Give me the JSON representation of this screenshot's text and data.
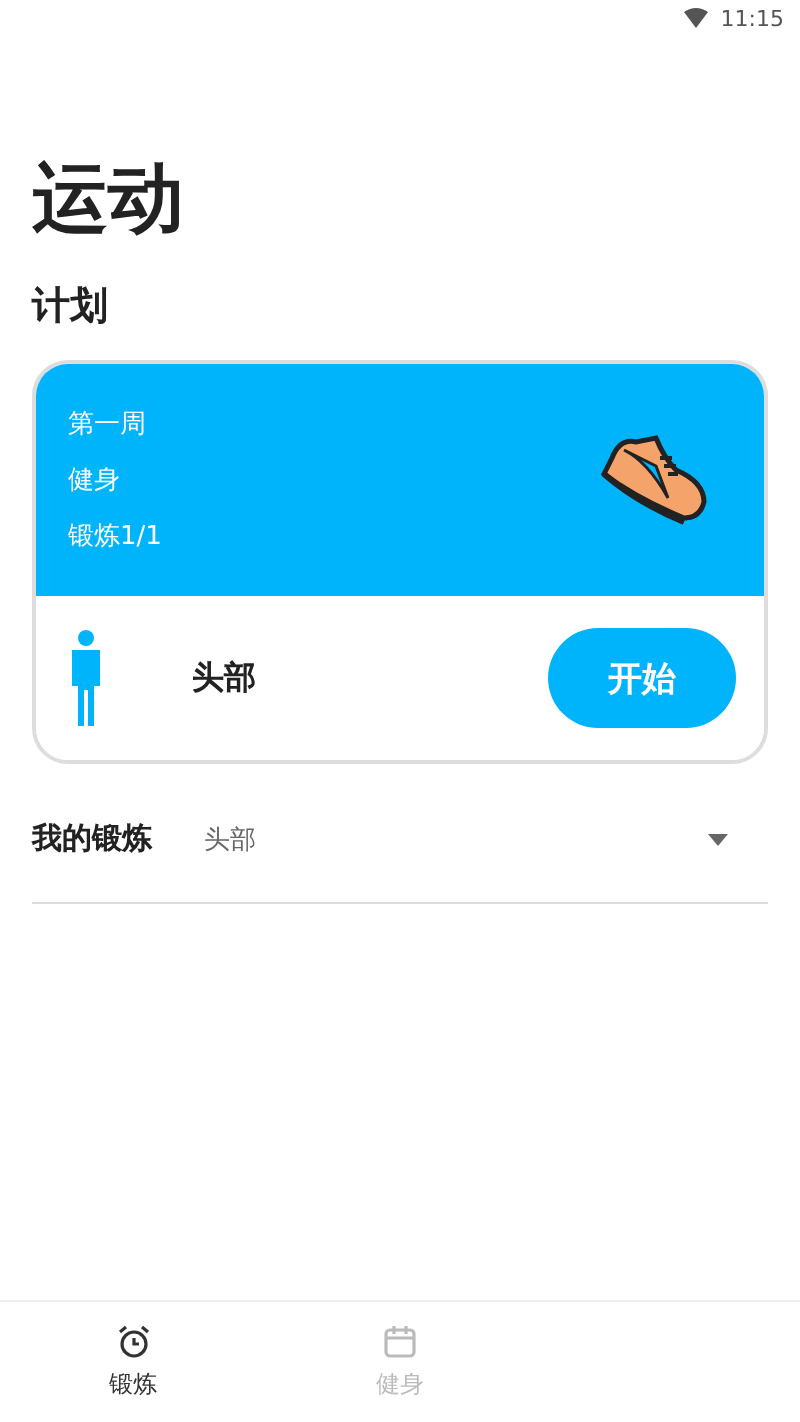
{
  "status_bar": {
    "time": "11:15"
  },
  "title": "运动",
  "plan": {
    "heading": "计划",
    "lines": [
      "第一周",
      "健身",
      "锻炼1/1"
    ],
    "part": "头部",
    "button": "开始"
  },
  "my_training": {
    "label": "我的锻炼",
    "value": "头部"
  },
  "bottom_nav": [
    {
      "label": "锻炼",
      "kind": "alarm",
      "selected": true
    },
    {
      "label": "健身",
      "kind": "calendar",
      "selected": false
    }
  ]
}
